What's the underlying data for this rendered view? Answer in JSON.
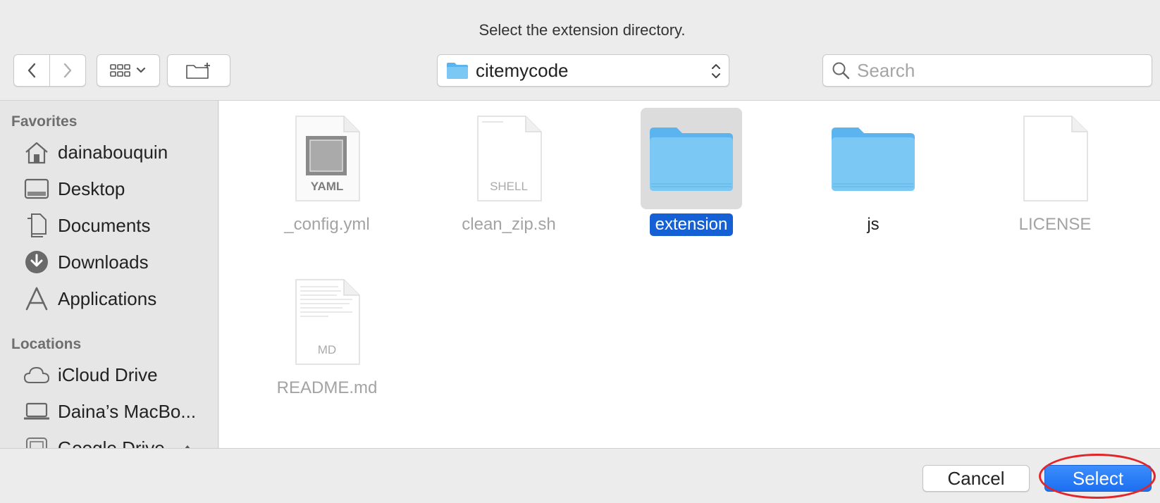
{
  "dialog": {
    "title": "Select the extension directory."
  },
  "toolbar": {
    "path_label": "citemycode",
    "search_placeholder": "Search"
  },
  "sidebar": {
    "favorites_header": "Favorites",
    "favorites": [
      {
        "label": "dainabouquin",
        "icon": "home-icon"
      },
      {
        "label": "Desktop",
        "icon": "desktop-icon"
      },
      {
        "label": "Documents",
        "icon": "documents-icon"
      },
      {
        "label": "Downloads",
        "icon": "downloads-icon"
      },
      {
        "label": "Applications",
        "icon": "applications-icon"
      }
    ],
    "locations_header": "Locations",
    "locations": [
      {
        "label": "iCloud Drive",
        "icon": "cloud-icon"
      },
      {
        "label": "Daina’s MacBo...",
        "icon": "laptop-icon"
      },
      {
        "label": "Google Drive",
        "icon": "drive-icon"
      }
    ]
  },
  "files": [
    {
      "name": "_config.yml",
      "kind": "document",
      "ext": "YAML",
      "enabled": false
    },
    {
      "name": "clean_zip.sh",
      "kind": "document",
      "ext": "SHELL",
      "enabled": false
    },
    {
      "name": "extension",
      "kind": "folder",
      "selected": true,
      "enabled": true
    },
    {
      "name": "js",
      "kind": "folder",
      "enabled": true
    },
    {
      "name": "LICENSE",
      "kind": "document",
      "enabled": false
    },
    {
      "name": "README.md",
      "kind": "document",
      "ext": "MD",
      "enabled": false
    }
  ],
  "buttons": {
    "cancel": "Cancel",
    "select": "Select"
  },
  "colors": {
    "accent": "#1560d4",
    "folder": "#7cc8f4",
    "annotation": "#e0262b"
  }
}
